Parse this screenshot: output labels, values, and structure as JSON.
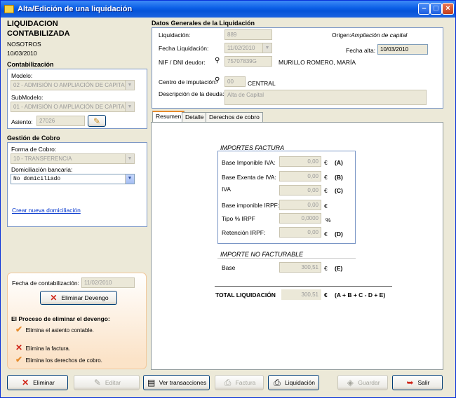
{
  "window": {
    "title": "Alta/Edición de una liquidación"
  },
  "header": {
    "title_line1": "LIQUIDACION",
    "title_line2": "CONTABILIZADA",
    "company": "NOSOTROS",
    "date": "10/03/2010"
  },
  "contabilizacion": {
    "title": "Contabilización",
    "modelo_label": "Modelo:",
    "modelo_value": "02 - ADMISIÓN O AMPLIACIÓN DE CAPITA",
    "submodelo_label": "SubModelo:",
    "submodelo_value": "01 - ADMISIÓN O AMPLIACIÓN DE CAPITA",
    "asiento_label": "Asiento:",
    "asiento_value": "27026"
  },
  "gestion": {
    "title": "Gestión de Cobro",
    "forma_label": "Forma de Cobro:",
    "forma_value": "10 - TRANSFERENCIA",
    "domiciliacion_label": "Domiciliación bancaria:",
    "domiciliacion_value": "No domiciliado",
    "nueva_link": "Crear nueva domiciliación"
  },
  "devengo": {
    "fecha_label": "Fecha de contabilización:",
    "fecha_value": "11/02/2010",
    "eliminar_button": "Eliminar Devengo",
    "process_title": "El Proceso de eliminar el devengo:",
    "steps": [
      {
        "text": "Elimina el asiento contable.",
        "status": "check"
      },
      {
        "text": "Elimina la factura.",
        "status": "cross"
      },
      {
        "text": "Elimina los derechos de cobro.",
        "status": "check"
      }
    ]
  },
  "datos": {
    "title": "Datos Generales de la Liquidación",
    "liquidacion_label": "Liquidación:",
    "liquidacion_value": "889",
    "origen_label": "Origen:",
    "origen_value": "Ampliación de capital",
    "fecha_liq_label": "Fecha Liquidación:",
    "fecha_liq_value": "11/02/2010",
    "fecha_alta_label": "Fecha alta:",
    "fecha_alta_value": "10/03/2010",
    "nif_label": "NIF / DNI deudor:",
    "nif_value": "75707839G",
    "deudor_name": "MURILLO ROMERO, MARÍA",
    "centro_label": "Centro de imputación:",
    "centro_value": "00",
    "centro_name": "CENTRAL",
    "descripcion_label": "Descripción de la deuda:",
    "descripcion_value": "Alta de Capital"
  },
  "tabs": [
    {
      "label": "Resumen"
    },
    {
      "label": "Detalle"
    },
    {
      "label": "Derechos de cobro"
    }
  ],
  "importes": {
    "title": "IMPORTES FACTURA",
    "currency": "€",
    "rows": [
      {
        "label": "Base Imponible IVA:",
        "value": "0,00",
        "tag": "(A)"
      },
      {
        "label": "Base Exenta de IVA:",
        "value": "0,00",
        "tag": "(B)"
      },
      {
        "label": "IVA",
        "value": "0,00",
        "tag": "(C)"
      },
      {
        "label": "Base imponible IRPF:",
        "value": "0,00",
        "tag": ""
      },
      {
        "label": "Tipo % IRPF",
        "value": "0,0000",
        "tag": ""
      },
      {
        "label": "Retención IRPF:",
        "value": "0,00",
        "tag": "(D)"
      }
    ],
    "tipo_unit": "%"
  },
  "no_facturable": {
    "title": "IMPORTE NO FACTURABLE",
    "base_label": "Base",
    "base_value": "300,51",
    "tag": "(E)"
  },
  "total": {
    "label": "TOTAL LIQUIDACIÓN",
    "value": "300,51",
    "formula": "(A + B + C - D + E)"
  },
  "toolbar": {
    "eliminar": "Eliminar",
    "editar": "Editar",
    "ver": "Ver transacciones",
    "factura": "Factura",
    "liquidacion": "Liquidación",
    "guardar": "Guardar",
    "salir": "Salir"
  }
}
